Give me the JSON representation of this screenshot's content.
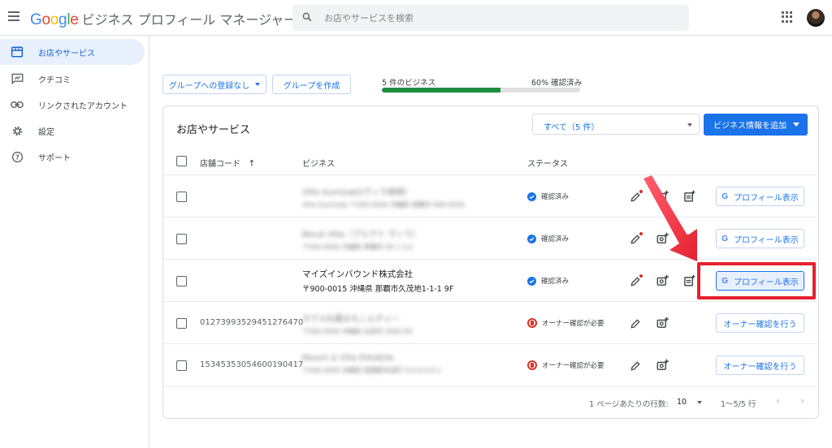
{
  "app": {
    "brand_google": "Google",
    "brand_title": "ビジネス プロフィール マネージャー"
  },
  "search": {
    "placeholder": "お店やサービスを検索"
  },
  "sidebar": {
    "items": [
      {
        "label": "お店やサービス",
        "icon": "storefront-icon",
        "active": true
      },
      {
        "label": "クチコミ",
        "icon": "review-icon",
        "active": false
      },
      {
        "label": "リンクされたアカウント",
        "icon": "link-icon",
        "active": false
      },
      {
        "label": "設定",
        "icon": "gear-icon",
        "active": false
      },
      {
        "label": "サポート",
        "icon": "help-icon",
        "active": false
      }
    ]
  },
  "toolbar": {
    "group_dropdown": "グループへの登録なし",
    "create_group": "グループを作成",
    "business_count": "5 件のビジネス",
    "verified_percent_text": "60% 確認済み",
    "verified_fraction": 0.6
  },
  "card": {
    "title": "お店やサービス",
    "filter_label": "すべて（5 件）",
    "add_button": "ビジネス情報を追加",
    "columns": {
      "code": "店舗コード",
      "business": "ビジネス",
      "status": "ステータス"
    }
  },
  "rows": [
    {
      "code": "",
      "name": "Villa Gumizaki(ヴィラ美崎)",
      "address": "Villa Gumizaki 〒000-0000 沖縄県 那覇市 000-0000",
      "blurred": true,
      "status": "確認済み",
      "status_type": "verified",
      "action": "プロフィール表示",
      "action_type": "profile"
    },
    {
      "code": "",
      "name": "Bleuk Villa（ブルクト ヴィラ）",
      "address": "〒000-0000 沖縄県 那覇市 00 1-3-0",
      "blurred": true,
      "status": "確認済み",
      "status_type": "verified",
      "action": "プロフィール表示",
      "action_type": "profile"
    },
    {
      "code": "",
      "name": "マイズインバウンド株式会社",
      "address": "〒900-0015 沖縄県 那覇市久茂地1-1-1 9F",
      "blurred": false,
      "status": "確認済み",
      "status_type": "verified",
      "action": "プロフィール表示",
      "action_type": "profile",
      "selected": true
    },
    {
      "code": "01273993529451276470",
      "name": "ホテル比嘉＆もこんチャー",
      "address": "〒000-0000 沖縄県 石垣市 0000-00",
      "blurred": true,
      "status": "オーナー確認が必要",
      "status_type": "warning",
      "action": "オーナー確認を行う",
      "action_type": "verify"
    },
    {
      "code": "15345353054600190417",
      "name": "Resort & Villa EHUKOA",
      "address": "〒000-0000 沖縄県 国頭郡本部町 0-0-0-0-0-1",
      "blurred": true,
      "status": "オーナー確認が必要",
      "status_type": "warning",
      "action": "オーナー確認を行う",
      "action_type": "verify"
    }
  ],
  "pager": {
    "rows_per_page_label": "1 ページあたりの行数:",
    "rows_per_page": "10",
    "range": "1～5/5 行"
  },
  "colors": {
    "accent": "#1a73e8",
    "verified": "#1a73e8",
    "warning": "#d93025",
    "progress": "#1e8e3e",
    "highlight": "#e5202e"
  }
}
